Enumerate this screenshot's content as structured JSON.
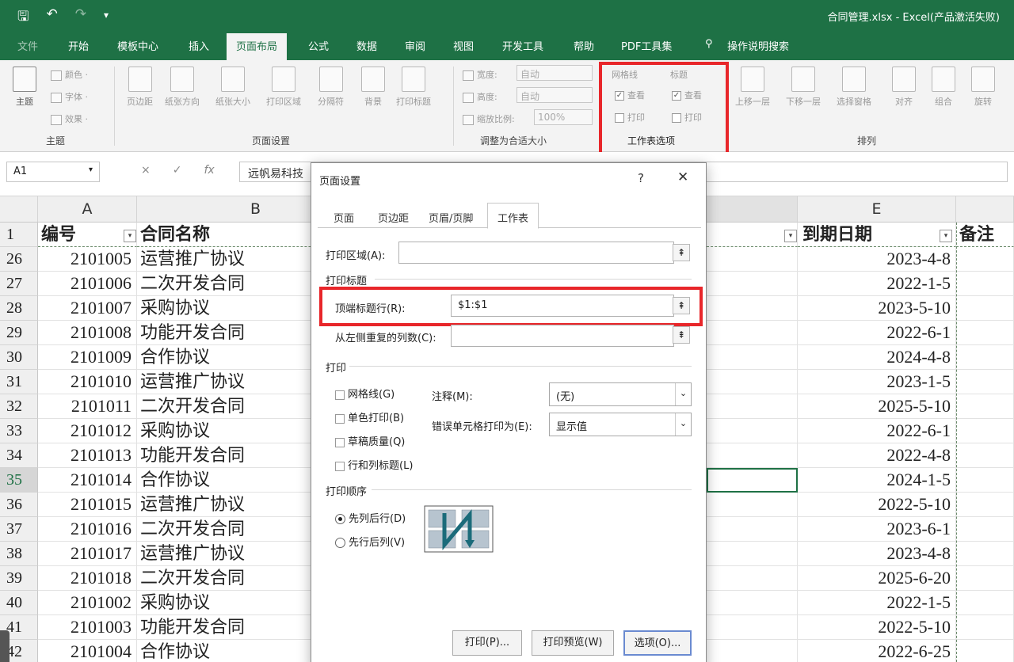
{
  "window": {
    "title": "合同管理.xlsx  -  Excel(产品激活失败)",
    "quick_access": [
      "save-icon",
      "undo-icon",
      "redo-icon",
      "customize-icon"
    ]
  },
  "ribbon_tabs": [
    "文件",
    "开始",
    "模板中心",
    "插入",
    "页面布局",
    "公式",
    "数据",
    "审阅",
    "视图",
    "开发工具",
    "帮助",
    "PDF工具集"
  ],
  "active_tab": "页面布局",
  "tell_me": "操作说明搜索",
  "ribbon": {
    "theme": {
      "big": "主题",
      "colors": "颜色 ·",
      "fonts": "字体 ·",
      "effects": "效果 ·",
      "label": "主题"
    },
    "page_setup": {
      "buttons": [
        "页边距",
        "纸张方向",
        "纸张大小",
        "打印区域",
        "分隔符",
        "背景",
        "打印标题"
      ],
      "label": "页面设置"
    },
    "scale": {
      "width_label": "宽度:",
      "width_value": "自动",
      "height_label": "高度:",
      "height_value": "自动",
      "scale_label": "缩放比例:",
      "scale_value": "100%",
      "label": "调整为合适大小"
    },
    "sheet_options": {
      "gridlines": "网格线",
      "headings": "标题",
      "view": "查看",
      "print": "打印",
      "label": "工作表选项"
    },
    "arrange": {
      "buttons": [
        "上移一层",
        "下移一层",
        "选择窗格",
        "对齐",
        "组合",
        "旋转"
      ],
      "label": "排列"
    }
  },
  "formula_bar": {
    "name_box": "A1",
    "cancel": "×",
    "enter": "✓",
    "fx": "fx",
    "content": "远帆易科技"
  },
  "columns": {
    "a": "A",
    "b": "B",
    "e": "E"
  },
  "header_row": {
    "num": "1",
    "a": "编号",
    "b": "合同名称",
    "e": "到期日期",
    "f": "备注"
  },
  "rows": [
    {
      "num": "26",
      "id": "2101005",
      "name": "运营推广协议",
      "date": "2023-4-8"
    },
    {
      "num": "27",
      "id": "2101006",
      "name": "二次开发合同",
      "date": "2022-1-5"
    },
    {
      "num": "28",
      "id": "2101007",
      "name": "采购协议",
      "date": "2023-5-10"
    },
    {
      "num": "29",
      "id": "2101008",
      "name": "功能开发合同",
      "date": "2022-6-1"
    },
    {
      "num": "30",
      "id": "2101009",
      "name": "合作协议",
      "date": "2024-4-8"
    },
    {
      "num": "31",
      "id": "2101010",
      "name": "运营推广协议",
      "date": "2023-1-5"
    },
    {
      "num": "32",
      "id": "2101011",
      "name": "二次开发合同",
      "date": "2025-5-10"
    },
    {
      "num": "33",
      "id": "2101012",
      "name": "采购协议",
      "date": "2022-6-1"
    },
    {
      "num": "34",
      "id": "2101013",
      "name": "功能开发合同",
      "date": "2022-4-8"
    },
    {
      "num": "35",
      "id": "2101014",
      "name": "合作协议",
      "date": "2024-1-5"
    },
    {
      "num": "36",
      "id": "2101015",
      "name": "运营推广协议",
      "date": "2022-5-10"
    },
    {
      "num": "37",
      "id": "2101016",
      "name": "二次开发合同",
      "date": "2023-6-1"
    },
    {
      "num": "38",
      "id": "2101017",
      "name": "运营推广协议",
      "date": "2023-4-8"
    },
    {
      "num": "39",
      "id": "2101018",
      "name": "二次开发合同",
      "date": "2025-6-20"
    },
    {
      "num": "40",
      "id": "2101002",
      "name": "采购协议",
      "date": "2022-1-5"
    },
    {
      "num": "41",
      "id": "2101003",
      "name": "功能开发合同",
      "date": "2022-5-10"
    },
    {
      "num": "42",
      "id": "2101004",
      "name": "合作协议",
      "date": "2022-6-25"
    }
  ],
  "dialog": {
    "title": "页面设置",
    "help": "?",
    "close": "✕",
    "tabs": [
      "页面",
      "页边距",
      "页眉/页脚",
      "工作表"
    ],
    "active_tab": "工作表",
    "print_area_label": "打印区域(A):",
    "print_area_value": "",
    "print_titles_section": "打印标题",
    "top_rows_label": "顶端标题行(R):",
    "top_rows_value": "$1:$1",
    "left_cols_label": "从左侧重复的列数(C):",
    "left_cols_value": "",
    "print_section": "打印",
    "gridlines": "网格线(G)",
    "black_white": "单色打印(B)",
    "draft": "草稿质量(Q)",
    "row_col_headings": "行和列标题(L)",
    "comments_label": "注释(M):",
    "comments_value": "(无)",
    "errors_label": "错误单元格打印为(E):",
    "errors_value": "显示值",
    "order_section": "打印顺序",
    "down_then_over": "先列后行(D)",
    "over_then_down": "先行后列(V)",
    "selected_order": "先列后行(D)",
    "btn_print": "打印(P)...",
    "btn_preview": "打印预览(W)",
    "btn_options": "选项(O)..."
  }
}
